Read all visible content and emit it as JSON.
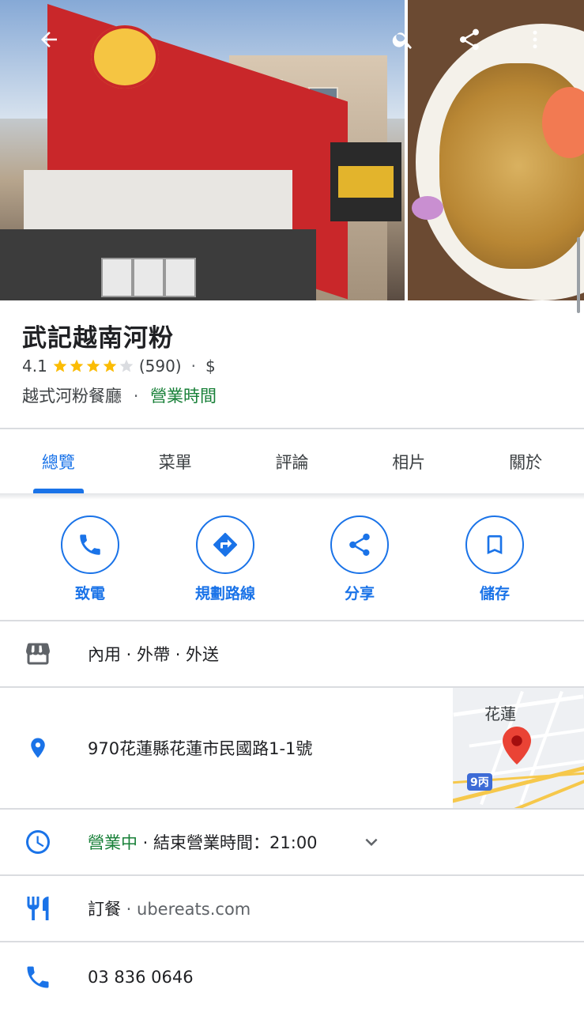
{
  "place": {
    "name": "武記越南河粉",
    "rating": "4.1",
    "stars": 4,
    "review_count": "(590)",
    "price": "$",
    "category": "越式河粉餐廳",
    "hours_link": "營業時間",
    "dot": "·"
  },
  "tabs": [
    {
      "label": "總覽",
      "active": true
    },
    {
      "label": "菜單"
    },
    {
      "label": "評論"
    },
    {
      "label": "相片"
    },
    {
      "label": "關於"
    }
  ],
  "actions": [
    {
      "label": "致電",
      "icon": "phone-icon"
    },
    {
      "label": "規劃路線",
      "icon": "directions-icon"
    },
    {
      "label": "分享",
      "icon": "share-icon"
    },
    {
      "label": "儲存",
      "icon": "bookmark-icon"
    }
  ],
  "info": {
    "service_options": "內用 · 外帶 · 外送",
    "address": "970花蓮縣花蓮市民國路1-1號",
    "hours_status": "營業中",
    "hours_rest": " · 結束營業時間：21:00",
    "order_label": "訂餐",
    "order_site": " · ubereats.com",
    "phone": "03 836 0646"
  },
  "map": {
    "city_label": "花蓮",
    "route_label": "9丙"
  },
  "colors": {
    "accent": "#1a73e8",
    "open_green": "#188038",
    "star": "#fbbc04",
    "pin": "#ea4335"
  }
}
